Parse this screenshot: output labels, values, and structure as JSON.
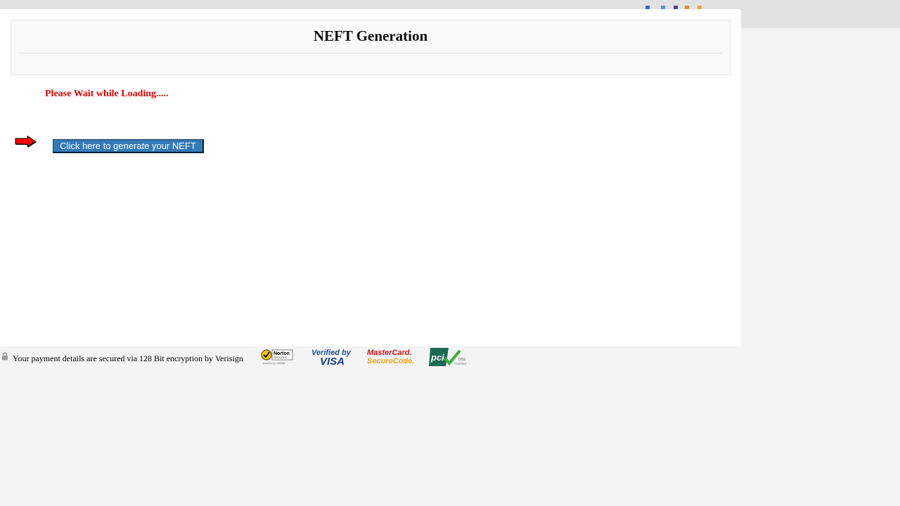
{
  "page": {
    "title": "NEFT Generation",
    "loading_message": "Please Wait while Loading.....",
    "generate_button_label": "Click here to generate your NEFT"
  },
  "footer": {
    "security_text": "Your payment details are secured via 128 Bit encryption by Verisign",
    "badges": {
      "norton_line1": "Norton",
      "norton_line2": "SECURED",
      "norton_line3": "powered by VeriSign",
      "visa_line1": "Verified by",
      "visa_line2": "VISA",
      "mastercard_line1": "MasterCard.",
      "mastercard_line2": "SecureCode.",
      "pci_main": "pci",
      "pci_sub1": "DSS",
      "pci_sub2": "Certified"
    }
  },
  "colors": {
    "loading_text": "#e10000",
    "button_bg": "#3379b7",
    "page_bg": "#f4f4f4"
  },
  "icons": [
    "arrow-right-icon",
    "lock-icon"
  ]
}
